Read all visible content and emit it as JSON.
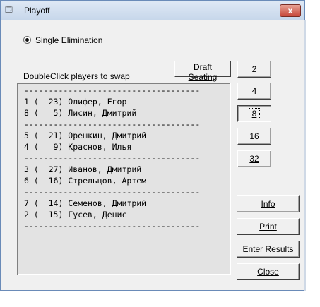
{
  "window": {
    "title": "Playoff",
    "close_glyph": "x"
  },
  "mode": {
    "label": "Single Elimination",
    "selected": true
  },
  "instructions": "DoubleClick players to swap",
  "buttons": {
    "draft": "Draft Seating",
    "info": "Info",
    "print": "Print",
    "enter_results": "Enter Results",
    "close": "Close"
  },
  "sizes": [
    {
      "label": "2",
      "selected": false
    },
    {
      "label": "4",
      "selected": false
    },
    {
      "label": "8",
      "selected": true
    },
    {
      "label": "16",
      "selected": false
    },
    {
      "label": "32",
      "selected": false
    }
  ],
  "bracket": {
    "separator": "------------------------------------",
    "matches": [
      [
        "1 (  23) Олифер, Егор",
        "8 (   5) Лисин, Дмитрий"
      ],
      [
        "5 (  21) Орешкин, Дмитрий",
        "4 (   9) Краснов, Илья"
      ],
      [
        "3 (  27) Иванов, Дмитрий",
        "6 (  16) Стрельцов, Артем"
      ],
      [
        "7 (  14) Семенов, Дмитрий",
        "2 (  15) Гусев, Денис"
      ]
    ]
  }
}
